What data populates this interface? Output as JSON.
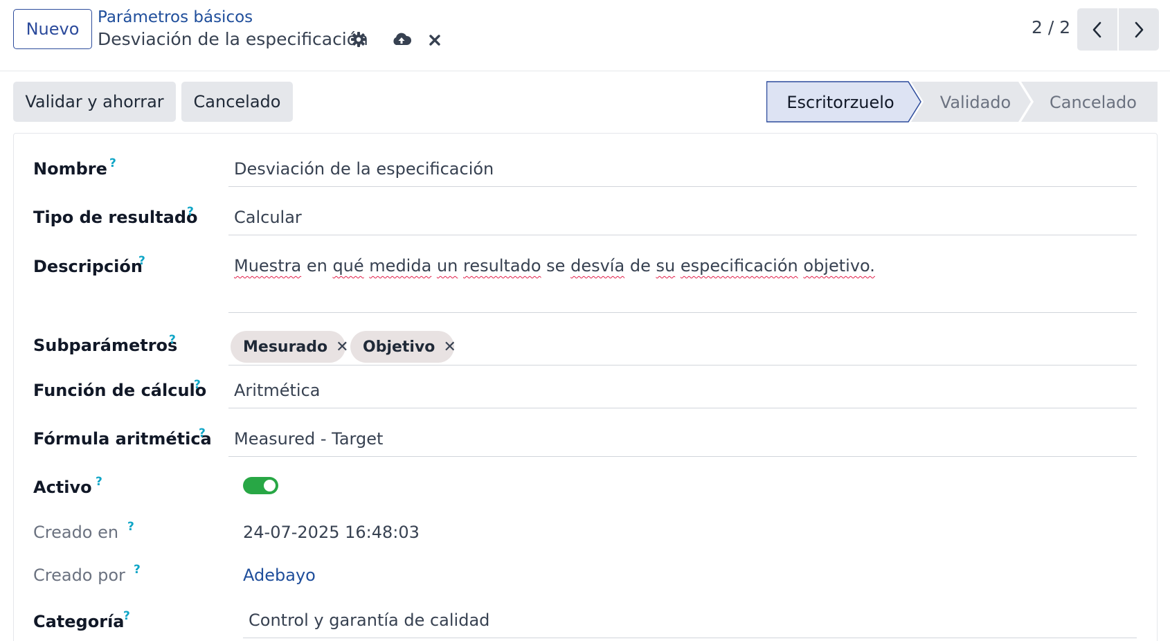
{
  "header": {
    "new_button": "Nuevo",
    "breadcrumb_parent": "Parámetros básicos",
    "record_title": "Desviación de la especificación",
    "pager": "2 / 2"
  },
  "actions": {
    "validate_save": "Validar y ahorrar",
    "cancel": "Cancelado"
  },
  "status": {
    "stages": [
      {
        "label": "Escritorzuelo",
        "active": true
      },
      {
        "label": "Validado",
        "active": false
      },
      {
        "label": "Cancelado",
        "active": false
      }
    ]
  },
  "form": {
    "name": {
      "label": "Nombre",
      "value": "Desviación de la especificación"
    },
    "result_type": {
      "label": "Tipo de resultado",
      "value": "Calcular"
    },
    "description": {
      "label": "Descripción",
      "words": [
        "Muestra",
        "en",
        "qué",
        "medida",
        "un",
        "resultado",
        "se",
        "desvía",
        "de",
        "su",
        "especificación",
        "objetivo."
      ]
    },
    "subparameters": {
      "label": "Subparámetros",
      "tags": [
        "Mesurado",
        "Objetivo"
      ]
    },
    "calc_function": {
      "label": "Función de cálculo",
      "value": "Aritmética"
    },
    "formula": {
      "label": "Fórmula aritmética",
      "value": "Measured - Target"
    },
    "active": {
      "label": "Activo",
      "value": true
    },
    "created_on": {
      "label": "Creado en",
      "value": "24-07-2025 16:48:03"
    },
    "created_by": {
      "label": "Creado por",
      "value": "Adebayo"
    },
    "category": {
      "label": "Categoría",
      "value": "Control y garantía de calidad"
    }
  },
  "colors": {
    "brand": "#2b4a9b",
    "link": "#1f4e9b",
    "help": "#0ea5c6",
    "toggle_on": "#28a745",
    "stage_active_bg": "#dde3f3"
  }
}
